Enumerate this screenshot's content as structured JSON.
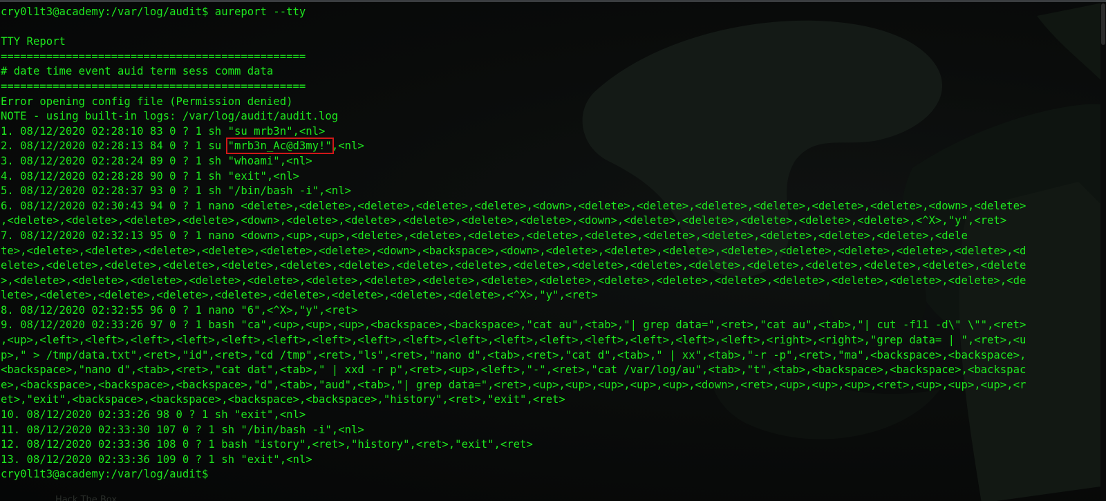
{
  "terminal": {
    "prompt_command": "cry0l1t3@academy:/var/log/audit$ aureport --tty",
    "title": "TTY Report",
    "separator": "===============================================",
    "header": "# date time event auid term sess comm data",
    "error": "Error opening config file (Permission denied)",
    "note": "NOTE - using built-in logs: /var/log/audit/audit.log",
    "rows": {
      "r1": "1. 08/12/2020 02:28:10 83 0 ? 1 sh \"su mrb3n\",<nl>",
      "r2_pre": "2. 08/12/2020 02:28:13 84 0 ? 1 su ",
      "r2_password": "\"mrb3n_Ac@d3my!\"",
      "r2_post": ",<nl>",
      "r3": "3. 08/12/2020 02:28:24 89 0 ? 1 sh \"whoami\",<nl>",
      "r4": "4. 08/12/2020 02:28:28 90 0 ? 1 sh \"exit\",<nl>",
      "r5": "5. 08/12/2020 02:28:37 93 0 ? 1 sh \"/bin/bash -i\",<nl>",
      "r6": [
        "6. 08/12/2020 02:30:43 94 0 ? 1 nano <delete>,<delete>,<delete>,<delete>,<delete>,<down>,<delete>,<delete>,<delete>,<delete>,<delete>,<delete>,<down>,<delete>",
        ",<delete>,<delete>,<delete>,<delete>,<down>,<delete>,<delete>,<delete>,<delete>,<delete>,<down>,<delete>,<delete>,<delete>,<delete>,<delete>,<^X>,\"y\",<ret>"
      ],
      "r7": [
        "7. 08/12/2020 02:32:13 95 0 ? 1 nano <down>,<up>,<up>,<delete>,<delete>,<delete>,<delete>,<delete>,<delete>,<delete>,<delete>,<delete>,<delete>,<dele",
        "te>,<delete>,<delete>,<delete>,<delete>,<delete>,<delete>,<down>,<backspace>,<down>,<delete>,<delete>,<delete>,<delete>,<delete>,<delete>,<delete>,<delete>,<d",
        "elete>,<delete>,<delete>,<delete>,<delete>,<delete>,<delete>,<delete>,<delete>,<delete>,<delete>,<delete>,<delete>,<delete>,<delete>,<delete>,<delete>,<delete",
        ">,<delete>,<delete>,<delete>,<delete>,<delete>,<delete>,<delete>,<delete>,<delete>,<delete>,<delete>,<delete>,<delete>,<delete>,<delete>,<delete>,<delete>,<de",
        "lete>,<delete>,<delete>,<delete>,<delete>,<delete>,<delete>,<delete>,<delete>,<^X>,\"y\",<ret>"
      ],
      "r8": "8. 08/12/2020 02:32:55 96 0 ? 1 nano \"6\",<^X>,\"y\",<ret>",
      "r9": [
        "9. 08/12/2020 02:33:26 97 0 ? 1 bash \"ca\",<up>,<up>,<up>,<backspace>,<backspace>,\"cat au\",<tab>,\"| grep data=\",<ret>,\"cat au\",<tab>,\"| cut -f11 -d\\\" \\\"\",<ret>",
        ",<up>,<left>,<left>,<left>,<left>,<left>,<left>,<left>,<left>,<left>,<left>,<left>,<left>,<left>,<left>,<left>,<left>,<right>,<right>,\"grep data= | \",<ret>,<u",
        "p>,\" > /tmp/data.txt\",<ret>,\"id\",<ret>,\"cd /tmp\",<ret>,\"ls\",<ret>,\"nano d\",<tab>,<ret>,\"cat d\",<tab>,\" | xx\",<tab>,\"-r -p\",<ret>,\"ma\",<backspace>,<backspace>,",
        "<backspace>,\"nano d\",<tab>,<ret>,\"cat dat\",<tab>,\" | xxd -r p\",<ret>,<up>,<left>,\"-\",<ret>,\"cat /var/log/au\",<tab>,\"t\",<tab>,<backspace>,<backspace>,<backspac",
        "e>,<backspace>,<backspace>,<backspace>,\"d\",<tab>,\"aud\",<tab>,\"| grep data=\",<ret>,<up>,<up>,<up>,<up>,<up>,<down>,<ret>,<up>,<up>,<up>,<ret>,<up>,<up>,<up>,<r",
        "et>,\"exit\",<backspace>,<backspace>,<backspace>,<backspace>,\"history\",<ret>,\"exit\",<ret>"
      ],
      "r10": "10. 08/12/2020 02:33:26 98 0 ? 1 sh \"exit\",<nl>",
      "r11": "11. 08/12/2020 02:33:30 107 0 ? 1 sh \"/bin/bash -i\",<nl>",
      "r12": "12. 08/12/2020 02:33:36 108 0 ? 1 bash \"istory\",<ret>,\"history\",<ret>,\"exit\",<ret>",
      "r13": "13. 08/12/2020 02:33:36 109 0 ? 1 sh \"exit\",<nl>"
    },
    "final_prompt": "cry0l1t3@academy:/var/log/audit$"
  },
  "background_label": "Hack The Box",
  "colors": {
    "text": "#1ee81e",
    "highlight_box": "#d01818",
    "background": "#0a0c0b"
  }
}
